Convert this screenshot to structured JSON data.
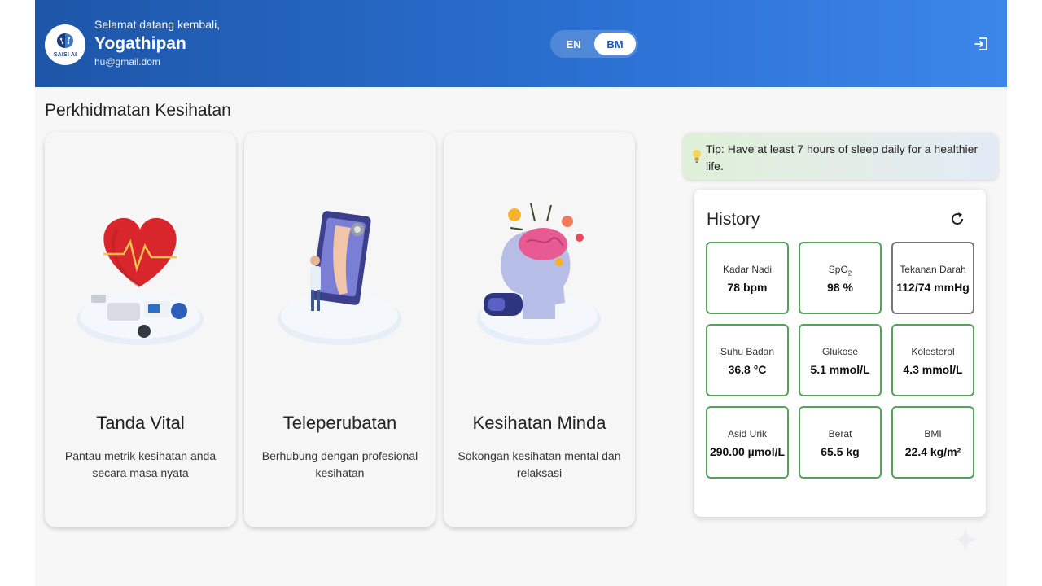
{
  "header": {
    "logo_text": "SAISI AI",
    "greeting": "Selamat datang kembali,",
    "user_name": "Yogathipan",
    "email": "hu@gmail.dom",
    "lang_en": "EN",
    "lang_bm": "BM",
    "active_lang": "BM",
    "logout_icon": "logout-icon"
  },
  "section_title": "Perkhidmatan Kesihatan",
  "services": [
    {
      "title": "Tanda Vital",
      "description": "Pantau metrik kesihatan anda secara masa nyata",
      "icon": "vital-signs-illustration"
    },
    {
      "title": "Teleperubatan",
      "description": "Berhubung dengan profesional kesihatan",
      "icon": "telemedicine-illustration"
    },
    {
      "title": "Kesihatan Minda",
      "description": "Sokongan kesihatan mental dan relaksasi",
      "icon": "mental-health-illustration"
    }
  ],
  "tip": {
    "text": "Tip: Have at least 7 hours of sleep daily for a healthier life.",
    "icon": "lightbulb-icon"
  },
  "history": {
    "title": "History",
    "refresh_icon": "refresh-icon",
    "metrics": [
      {
        "label": "Kadar Nadi",
        "value": "78 bpm"
      },
      {
        "label": "SpO",
        "label_sub": "2",
        "value": "98 %"
      },
      {
        "label": "Tekanan Darah",
        "value": "112/74 mmHg"
      },
      {
        "label": "Suhu Badan",
        "value": "36.8 °C"
      },
      {
        "label": "Glukose",
        "value": "5.1 mmol/L"
      },
      {
        "label": "Kolesterol",
        "value": "4.3 mmol/L"
      },
      {
        "label": "Asid Urik",
        "value": "290.00 µmol/L"
      },
      {
        "label": "Berat",
        "value": "65.5 kg"
      },
      {
        "label": "BMI",
        "value": "22.4 kg/m²"
      }
    ]
  },
  "colors": {
    "header_start": "#1d56a8",
    "header_end": "#3c86ea",
    "metric_border_good": "#55a25a",
    "metric_border_neutral": "#777777"
  }
}
